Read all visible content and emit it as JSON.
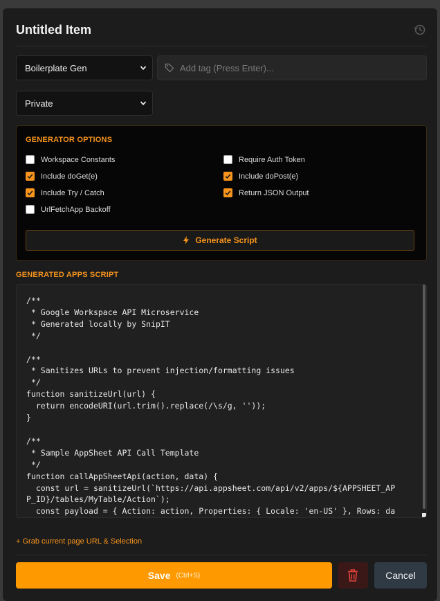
{
  "header": {
    "title": "Untitled Item",
    "history_icon": "history-icon"
  },
  "controls": {
    "type_select": {
      "value": "Boilerplate Gen"
    },
    "tag_input": {
      "placeholder": "Add tag (Press Enter)..."
    },
    "visibility_select": {
      "value": "Private"
    }
  },
  "generator": {
    "title": "GENERATOR OPTIONS",
    "options": [
      {
        "label": "Workspace Constants",
        "checked": false
      },
      {
        "label": "Require Auth Token",
        "checked": false
      },
      {
        "label": "Include doGet(e)",
        "checked": true
      },
      {
        "label": "Include doPost(e)",
        "checked": true
      },
      {
        "label": "Include Try / Catch",
        "checked": true
      },
      {
        "label": "Return JSON Output",
        "checked": true
      },
      {
        "label": "UrlFetchApp Backoff",
        "checked": false
      }
    ],
    "generate_label": "Generate Script"
  },
  "output": {
    "title": "GENERATED APPS SCRIPT",
    "code": "/**\n * Google Workspace API Microservice\n * Generated locally by SnipIT\n */\n\n/**\n * Sanitizes URLs to prevent injection/formatting issues\n */\nfunction sanitizeUrl(url) {\n  return encodeURI(url.trim().replace(/\\s/g, ''));\n}\n\n/**\n * Sample AppSheet API Call Template\n */\nfunction callAppSheetApi(action, data) {\n  const url = sanitizeUrl(`https://api.appsheet.com/api/v2/apps/${APPSHEET_APP_ID}/tables/MyTable/Action`);\n  const payload = { Action: action, Properties: { Locale: 'en-US' }, Rows: data };"
  },
  "grab_link": "+ Grab current page URL & Selection",
  "footer": {
    "save_label": "Save",
    "save_hint": "(Ctrl+S)",
    "cancel_label": "Cancel"
  },
  "colors": {
    "accent": "#f7941d",
    "save": "#ff9900",
    "delete_bg": "#3a1818",
    "cancel_bg": "#2f3a44"
  }
}
